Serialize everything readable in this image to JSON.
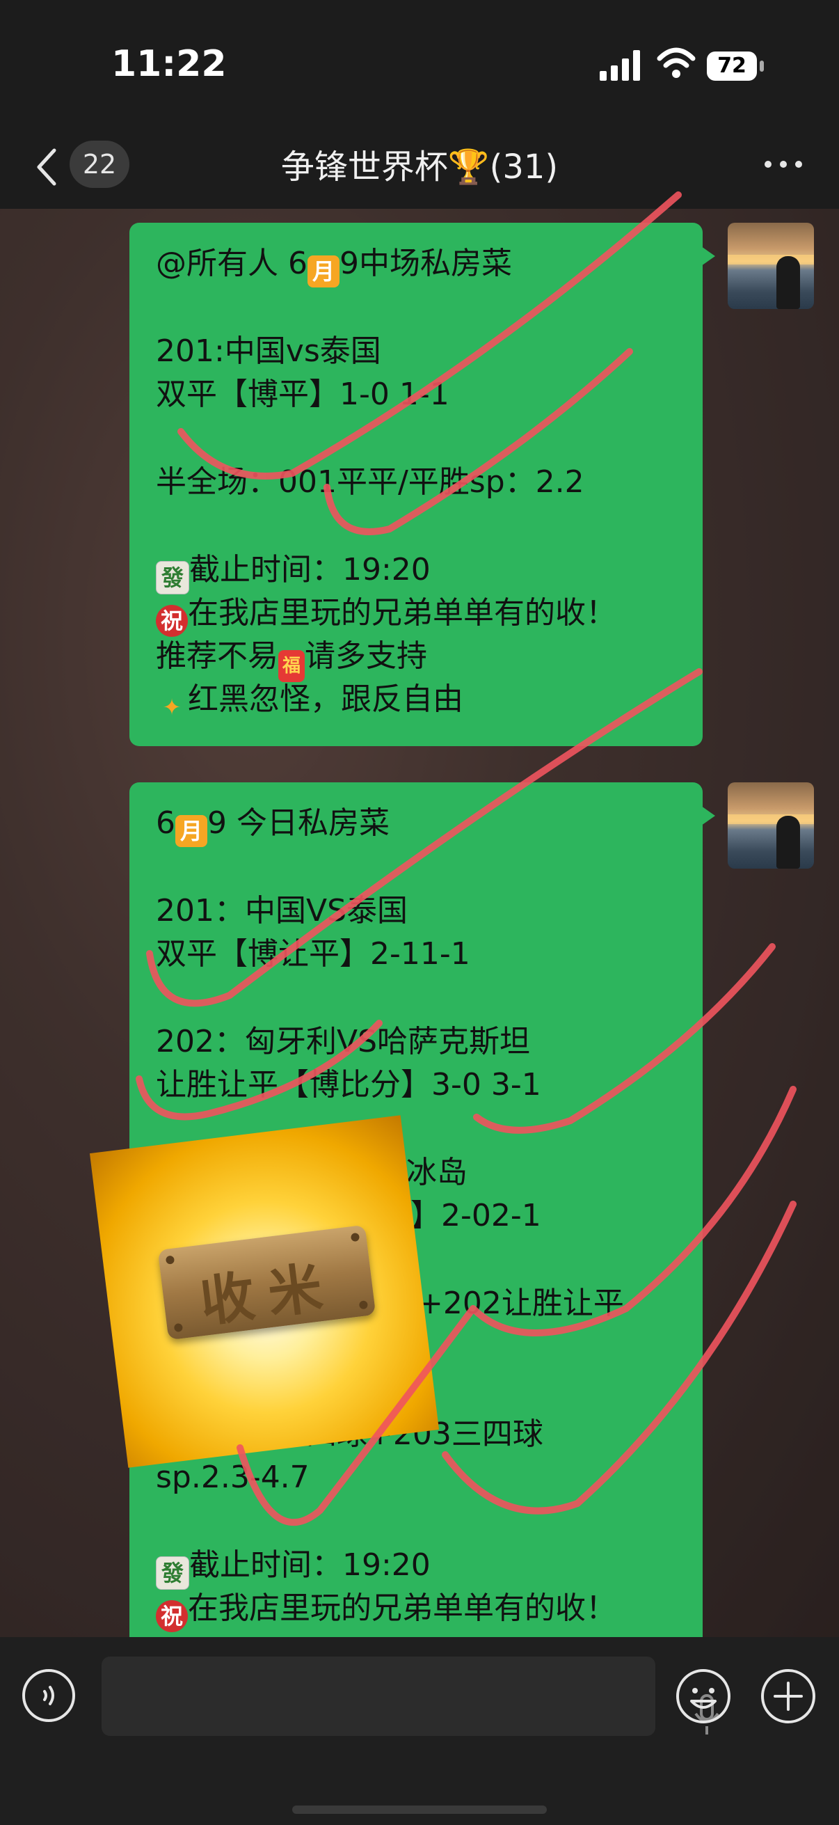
{
  "status_bar": {
    "time": "11:22",
    "battery": "72"
  },
  "nav": {
    "unread_count": "22",
    "title": "争锋世界杯🏆(31)"
  },
  "message1": {
    "lines": [
      "@所有人 6",
      "9中场私房菜",
      "201:中国vs泰国",
      "双平【博平】1-0 1-1",
      "半全场：001平平/平胜sp：2.2",
      "截止时间：19:20",
      "在我店里玩的兄弟单单有的收！",
      "推荐不易",
      "请多支持",
      "红黑忽怪，跟反自由"
    ]
  },
  "message2": {
    "lines": [
      "6",
      "9 今日私房菜",
      "201：中国VS泰国",
      "双平【博让平】2-11-1",
      "202：匈牙利VS哈萨克斯坦",
      "让胜让平【博比分】3-0 3-1",
      "S冰岛",
      "平】2-02-1",
      "球+202让胜让平",
      "串：202三四球+203三四球",
      "sp.2.3-4.7",
      "截止时间：19:20",
      "在我店里玩的兄弟单单有的收！"
    ]
  },
  "emoji": {
    "month": "月",
    "fa": "發",
    "zhu": "祝",
    "hongbao": "福"
  },
  "sticker": {
    "text": "收米"
  },
  "colors": {
    "bubble": "#2db55d",
    "scribble": "#f0545e"
  }
}
